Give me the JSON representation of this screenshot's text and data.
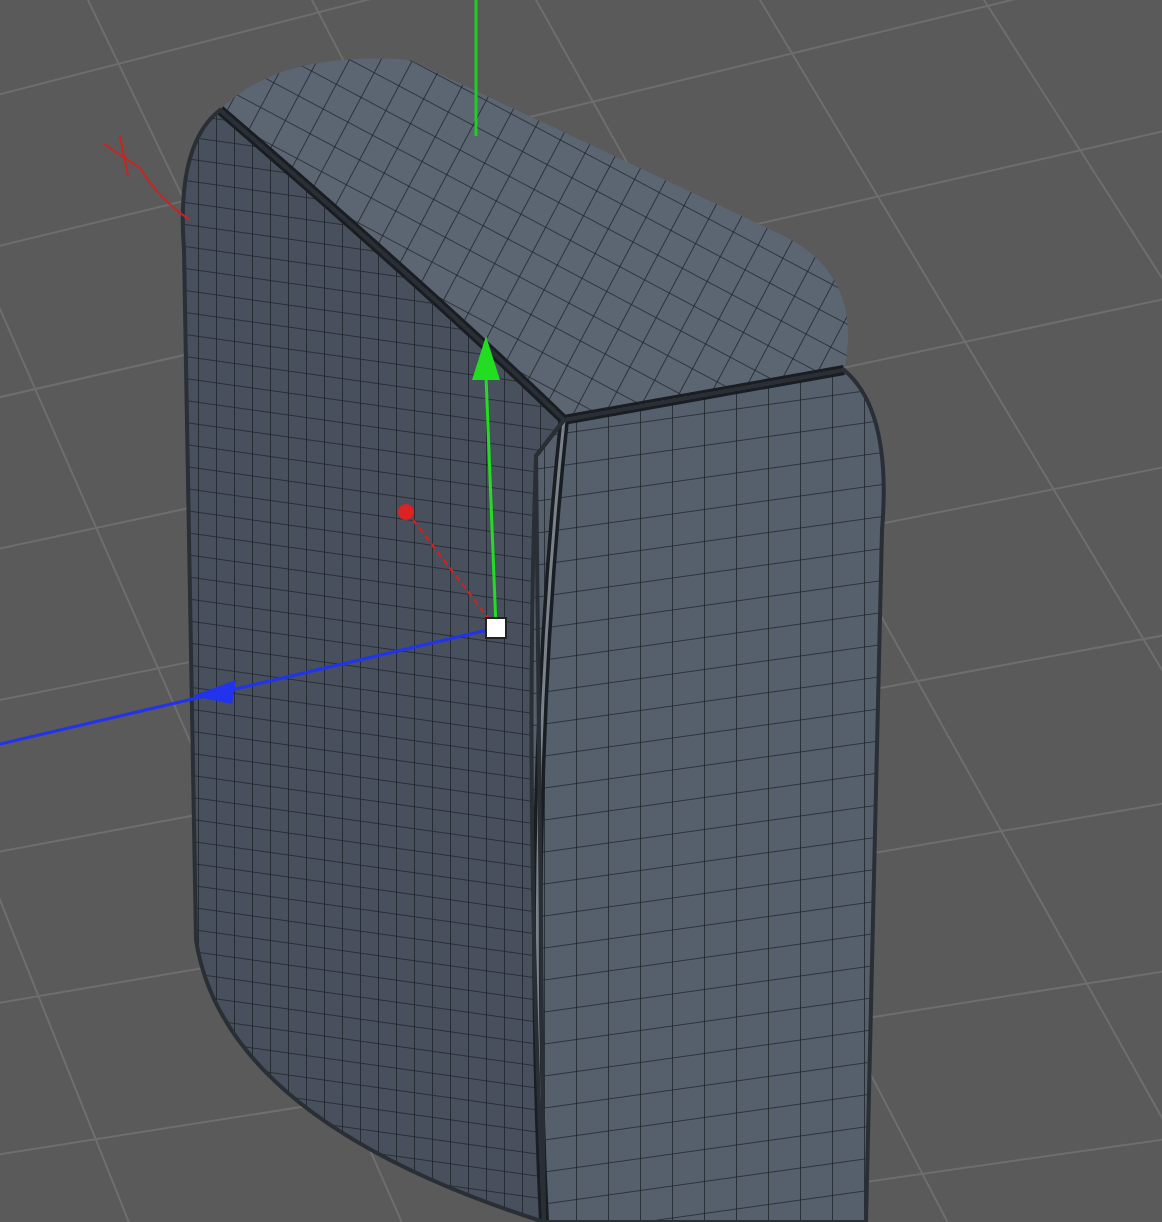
{
  "viewport": {
    "grid": true,
    "gizmo": true
  }
}
